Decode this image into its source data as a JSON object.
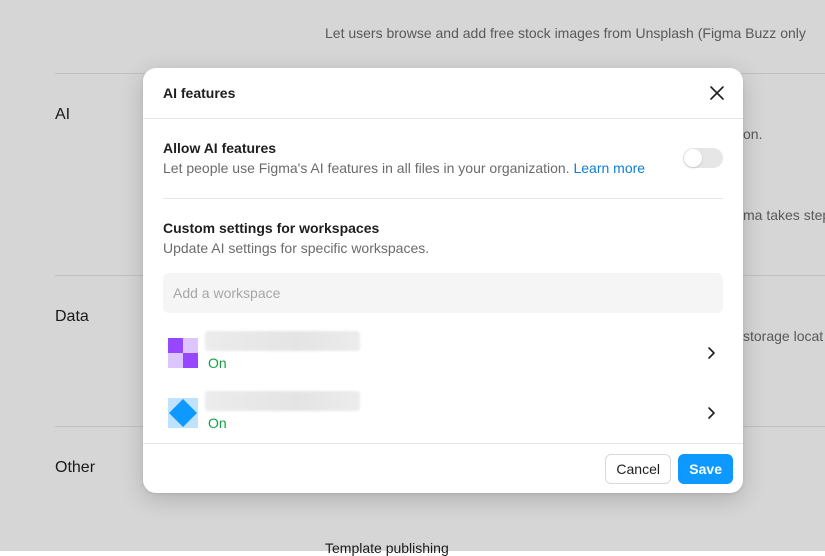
{
  "background": {
    "sections": [
      {
        "label": "AI"
      },
      {
        "label": "Data"
      },
      {
        "label": "Other"
      }
    ],
    "texts": {
      "top_line": "Let users browse and add free stock images from Unsplash (Figma Buzz only",
      "ai_fragment_1": "on.",
      "ai_fragment_2": "ma takes step",
      "data_fragment": "storage locat",
      "other_fragment": "",
      "bottom_line": "Template publishing"
    }
  },
  "modal": {
    "title": "AI features",
    "allow": {
      "title": "Allow AI features",
      "description": "Let people use Figma's AI features in all files in your organization.",
      "link": "Learn more",
      "enabled": false
    },
    "custom": {
      "title": "Custom settings for workspaces",
      "description": "Update AI settings for specific workspaces."
    },
    "search": {
      "placeholder": "Add a workspace",
      "value": ""
    },
    "workspaces": [
      {
        "status": "On",
        "icon": "purple-grid-icon"
      },
      {
        "status": "On",
        "icon": "blue-diamond-icon"
      }
    ],
    "footer": {
      "cancel_label": "Cancel",
      "save_label": "Save"
    }
  },
  "colors": {
    "accent": "#0d99ff",
    "link": "#0d7fd6",
    "status_on": "#14a046",
    "workspace1_primary": "#9747ff",
    "workspace1_light": "#dcc6ff",
    "workspace2_primary": "#0d99ff",
    "workspace2_light": "#bfe3ff"
  }
}
